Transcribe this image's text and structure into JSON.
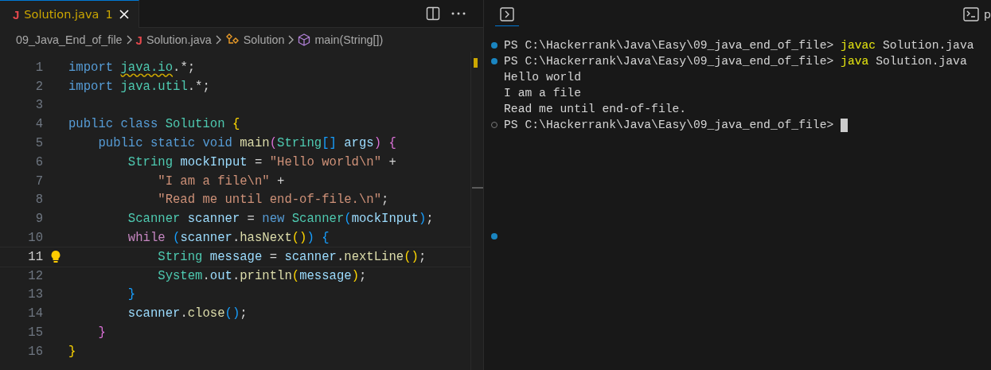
{
  "editor": {
    "tabs": [
      {
        "file_icon": "J",
        "label": "Solution.java",
        "problems": "1",
        "selected": true
      }
    ],
    "breadcrumbs": [
      {
        "kind": "folder",
        "label": "09_Java_End_of_file"
      },
      {
        "kind": "file",
        "file_icon": "J",
        "label": "Solution.java"
      },
      {
        "kind": "class",
        "label": "Solution"
      },
      {
        "kind": "method",
        "label": "main(String[])"
      }
    ],
    "lines": [
      {
        "number": "1",
        "tokens": [
          {
            "text": "import ",
            "kind": "keyword"
          },
          {
            "text": "java.io",
            "kind": "namespace",
            "warning": true
          },
          {
            "text": ".*;",
            "kind": "plain"
          }
        ]
      },
      {
        "number": "2",
        "tokens": [
          {
            "text": "import ",
            "kind": "keyword"
          },
          {
            "text": "java.util",
            "kind": "namespace"
          },
          {
            "text": ".*;",
            "kind": "plain"
          }
        ]
      },
      {
        "number": "3"
      },
      {
        "number": "4",
        "tokens": [
          {
            "text": "public class ",
            "kind": "keyword"
          },
          {
            "text": "Solution ",
            "kind": "type"
          },
          {
            "text": "{",
            "kind": "bracket1"
          }
        ]
      },
      {
        "number": "5",
        "tokens": [
          {
            "text": "    public static void ",
            "kind": "keyword"
          },
          {
            "text": "main",
            "kind": "func"
          },
          {
            "text": "(",
            "kind": "bracket2"
          },
          {
            "text": "String",
            "kind": "type"
          },
          {
            "text": "[]",
            "kind": "bracket3"
          },
          {
            "text": " args",
            "kind": "var"
          },
          {
            "text": ") {",
            "kind": "bracket2"
          }
        ]
      },
      {
        "number": "6",
        "tokens": [
          {
            "text": "        String ",
            "kind": "type"
          },
          {
            "text": "mockInput",
            "kind": "var"
          },
          {
            "text": " = ",
            "kind": "plain"
          },
          {
            "text": "\"Hello world\\n\"",
            "kind": "string"
          },
          {
            "text": " +",
            "kind": "plain"
          }
        ]
      },
      {
        "number": "7",
        "tokens": [
          {
            "text": "            \"I am a file\\n\"",
            "kind": "string"
          },
          {
            "text": " +",
            "kind": "plain"
          }
        ]
      },
      {
        "number": "8",
        "tokens": [
          {
            "text": "            \"Read me until end-of-file.\\n\"",
            "kind": "string"
          },
          {
            "text": ";",
            "kind": "plain"
          }
        ]
      },
      {
        "number": "9",
        "tokens": [
          {
            "text": "        Scanner ",
            "kind": "type"
          },
          {
            "text": "scanner",
            "kind": "var"
          },
          {
            "text": " = ",
            "kind": "plain"
          },
          {
            "text": "new ",
            "kind": "keyword"
          },
          {
            "text": "Scanner",
            "kind": "type"
          },
          {
            "text": "(",
            "kind": "bracket3"
          },
          {
            "text": "mockInput",
            "kind": "var"
          },
          {
            "text": ")",
            "kind": "bracket3"
          },
          {
            "text": ";",
            "kind": "plain"
          }
        ]
      },
      {
        "number": "10",
        "tokens": [
          {
            "text": "        while ",
            "kind": "control"
          },
          {
            "text": "(",
            "kind": "bracket3"
          },
          {
            "text": "scanner",
            "kind": "var"
          },
          {
            "text": ".",
            "kind": "plain"
          },
          {
            "text": "hasNext",
            "kind": "func"
          },
          {
            "text": "()",
            "kind": "bracket1"
          },
          {
            "text": ") {",
            "kind": "bracket3"
          }
        ]
      },
      {
        "number": "11",
        "current": true,
        "lightbulb": true,
        "tokens": [
          {
            "text": "            String ",
            "kind": "type"
          },
          {
            "text": "message",
            "kind": "var"
          },
          {
            "text": " = ",
            "kind": "plain"
          },
          {
            "text": "scanner",
            "kind": "var"
          },
          {
            "text": ".",
            "kind": "plain"
          },
          {
            "text": "nextLine",
            "kind": "func"
          },
          {
            "text": "()",
            "kind": "bracket1"
          },
          {
            "text": ";",
            "kind": "plain"
          }
        ]
      },
      {
        "number": "12",
        "tokens": [
          {
            "text": "            System",
            "kind": "type"
          },
          {
            "text": ".",
            "kind": "plain"
          },
          {
            "text": "out",
            "kind": "var"
          },
          {
            "text": ".",
            "kind": "plain"
          },
          {
            "text": "println",
            "kind": "func"
          },
          {
            "text": "(",
            "kind": "bracket1"
          },
          {
            "text": "message",
            "kind": "var"
          },
          {
            "text": ")",
            "kind": "bracket1"
          },
          {
            "text": ";",
            "kind": "plain"
          }
        ]
      },
      {
        "number": "13",
        "tokens": [
          {
            "text": "        }",
            "kind": "bracket3"
          }
        ]
      },
      {
        "number": "14",
        "tokens": [
          {
            "text": "        scanner",
            "kind": "var"
          },
          {
            "text": ".",
            "kind": "plain"
          },
          {
            "text": "close",
            "kind": "func"
          },
          {
            "text": "()",
            "kind": "bracket3"
          },
          {
            "text": ";",
            "kind": "plain"
          }
        ]
      },
      {
        "number": "15",
        "tokens": [
          {
            "text": "    }",
            "kind": "bracket2"
          }
        ]
      },
      {
        "number": "16",
        "tokens": [
          {
            "text": "}",
            "kind": "bracket1"
          }
        ]
      }
    ]
  },
  "terminal": {
    "tabs": [
      {
        "kind": "terminal",
        "selected": true
      }
    ],
    "session_label": "p",
    "lines": [
      {
        "kind": "success",
        "segments": [
          {
            "text": "PS C:\\Hackerrank\\Java\\Easy\\09_java_end_of_file> ",
            "kind": "plain"
          },
          {
            "text": "javac",
            "kind": "command"
          },
          {
            "text": " Solution.java",
            "kind": "plain"
          }
        ]
      },
      {
        "kind": "success",
        "segments": [
          {
            "text": "PS C:\\Hackerrank\\Java\\Easy\\09_java_end_of_file> ",
            "kind": "plain"
          },
          {
            "text": "java",
            "kind": "command"
          },
          {
            "text": " Solution.java",
            "kind": "plain"
          }
        ]
      },
      {
        "kind": "output",
        "segments": [
          {
            "text": "Hello world",
            "kind": "plain"
          }
        ]
      },
      {
        "kind": "output",
        "segments": [
          {
            "text": "I am a file",
            "kind": "plain"
          }
        ]
      },
      {
        "kind": "output",
        "segments": [
          {
            "text": "Read me until end-of-file.",
            "kind": "plain"
          }
        ]
      },
      {
        "kind": "pending",
        "cursor": true,
        "segments": [
          {
            "text": "PS C:\\Hackerrank\\Java\\Easy\\09_java_end_of_file> ",
            "kind": "plain"
          }
        ]
      },
      {
        "kind": "success"
      }
    ]
  }
}
